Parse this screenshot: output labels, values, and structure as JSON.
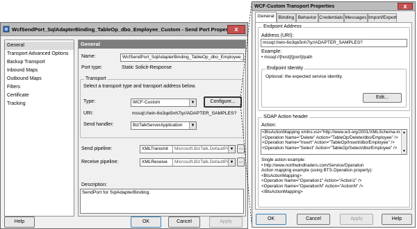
{
  "send_port_window": {
    "title": "WcfSendPort_SqlAdapterBinding_TableOp_dbo_Employee_Custom - Send Port Properties",
    "close_glyph": "x",
    "nav": [
      "General",
      "Transport Advanced Options",
      "Backup Transport",
      "Inbound Maps",
      "Outbound Maps",
      "Filters",
      "Certificate",
      "Tracking"
    ],
    "section_header": "General",
    "name_label": "Name:",
    "name_value": "WcfSendPort_SqlAdapterBinding_TableOp_dbo_Employee_Custom",
    "port_type_label": "Port type:",
    "port_type_value": "Static Solicit-Response",
    "transport_group": "Transport",
    "transport_hint": "Select a transport type and transport address below.",
    "type_label": "Type:",
    "type_value": "WCF-Custom",
    "configure_button": "Configure...",
    "uri_label": "URI:",
    "uri_value": "mssql://win-6o3qe5nh7iy//ADAPTER_SAMPLES?",
    "send_handler_label": "Send handler:",
    "send_handler_value": "BizTalkServerApplication",
    "send_pipeline_label": "Send pipeline:",
    "send_pipeline_value": "XMLTransmit",
    "send_pipeline_assembly": "Microsoft.BizTalk.DefaultPip",
    "receive_pipeline_label": "Receive pipeline:",
    "receive_pipeline_value": "XMLReceive",
    "receive_pipeline_assembly": "Microsoft.BizTalk.DefaultPip",
    "ellipsis": "...",
    "description_label": "Description:",
    "description_value": "SendPort for SqlAdapterBinding.",
    "help_button": "Help",
    "ok_button": "OK",
    "cancel_button": "Cancel",
    "apply_button": "Apply"
  },
  "wcf_window": {
    "title": "WCF-Custom Transport Properties",
    "close_glyph": "x",
    "tabs": [
      "General",
      "Binding",
      "Behavior",
      "Credentials",
      "Messages",
      "Import/Export"
    ],
    "endpoint_group": "Endpoint Address",
    "address_label": "Address (URI):",
    "address_value": "mssql://win-6o3qe5nh7iy//ADAPTER_SAMPLES?",
    "example_label": "Example:",
    "example_value": "• mssql://[host]/[port]/path",
    "identity_group": "Endpoint Identity",
    "identity_hint": "Optional: the expected service identity.",
    "edit_button": "Edit...",
    "soap_group": "SOAP Action header",
    "action_label": "Action:",
    "action_lines": [
      "<BtsActionMapping xmlns:xsi=\"http://www.w3.org/2001/XMLSchema-inst",
      "  <Operation Name=\"Delete\" Action=\"TableOp/Delete/dbo/Employee\" />",
      "  <Operation Name=\"Insert\" Action=\"TableOp/Insert/dbo/Employee\" />",
      "  <Operation Name=\"Select\" Action=\"TableOp/Select/dbo/Employee\" />"
    ],
    "example_text": [
      "Single action example:",
      "• http://www.northwindtraders.com/Service/Operation",
      "Action mapping example (using BTS.Operation property):",
      "<BtsActionMapping>",
      "  <Operation Name=\"Operation1\" Action=\"Action1\" />",
      "  <Operation Name=\"OperationN\" Action=\"ActionN\" />",
      "</BtsActionMapping>"
    ],
    "ok_button": "OK",
    "cancel_button": "Cancel",
    "apply_button": "Apply",
    "help_button": "Help"
  }
}
